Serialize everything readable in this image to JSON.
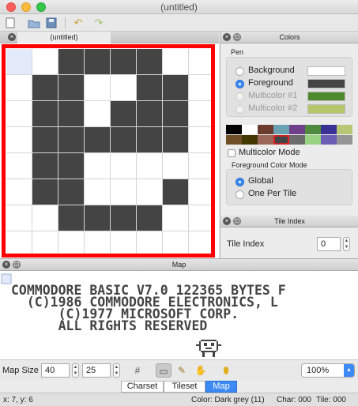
{
  "window": {
    "title": "(untitled)"
  },
  "editor_tab": {
    "title": "(untitled)"
  },
  "tile": {
    "rows": [
      [
        0,
        0,
        1,
        1,
        1,
        1,
        0,
        0
      ],
      [
        0,
        1,
        1,
        0,
        0,
        1,
        1,
        0
      ],
      [
        0,
        1,
        1,
        0,
        1,
        1,
        1,
        0
      ],
      [
        0,
        1,
        1,
        1,
        1,
        1,
        1,
        0
      ],
      [
        0,
        1,
        1,
        0,
        0,
        0,
        0,
        0
      ],
      [
        0,
        1,
        1,
        0,
        0,
        0,
        1,
        0
      ],
      [
        0,
        0,
        1,
        1,
        1,
        1,
        0,
        0
      ],
      [
        0,
        0,
        0,
        0,
        0,
        0,
        0,
        0
      ]
    ],
    "selected_cell": [
      0,
      0
    ],
    "on_color": "#444444",
    "selection_color": "#e3ebfb",
    "frame_color": "#ff0000"
  },
  "colors_panel": {
    "title": "Colors",
    "pen_label": "Pen",
    "pens": [
      {
        "label": "Background",
        "selected": false,
        "enabled": true,
        "color": "#ffffff"
      },
      {
        "label": "Foreground",
        "selected": true,
        "enabled": true,
        "color": "#444444"
      },
      {
        "label": "Multicolor #1",
        "selected": false,
        "enabled": false,
        "color": "#4c8a2c"
      },
      {
        "label": "Multicolor #2",
        "selected": false,
        "enabled": false,
        "color": "#b5c56a"
      }
    ],
    "palette": [
      "#000000",
      "#ffffff",
      "#6a3a2c",
      "#6aa2b2",
      "#6e3f8a",
      "#4f8a3e",
      "#3a3196",
      "#b8c776",
      "#6e4f26",
      "#433900",
      "#9a6759",
      "#444444",
      "#6c6c6c",
      "#9ad284",
      "#6c5eb5",
      "#959595"
    ],
    "multicolor_mode_label": "Multicolor Mode",
    "fg_mode_label": "Foreground Color Mode",
    "fg_modes": [
      {
        "label": "Global",
        "selected": true
      },
      {
        "label": "One Per Tile",
        "selected": false
      }
    ]
  },
  "tile_index_panel": {
    "title": "Tile Index",
    "label": "Tile Index",
    "value": "0"
  },
  "map_panel": {
    "title": "Map",
    "lines": [
      "COMMODORE BASIC V7.0 122365 BYTES F",
      "  (C)1986 COMMODORE ELECTRONICS, L",
      "      (C)1977 MICROSOFT CORP.",
      "      ALL RIGHTS RESERVED"
    ]
  },
  "bottom": {
    "map_size_label": "Map Size",
    "width": "40",
    "height": "25",
    "zoom": "100%"
  },
  "tabs": [
    {
      "label": "Charset",
      "active": false
    },
    {
      "label": "Tileset",
      "active": false
    },
    {
      "label": "Map",
      "active": true
    }
  ],
  "status": {
    "coords": "x: 7, y: 6",
    "color": "Color: Dark grey (11)",
    "char": "Char: 000",
    "tile": "Tile: 000"
  }
}
